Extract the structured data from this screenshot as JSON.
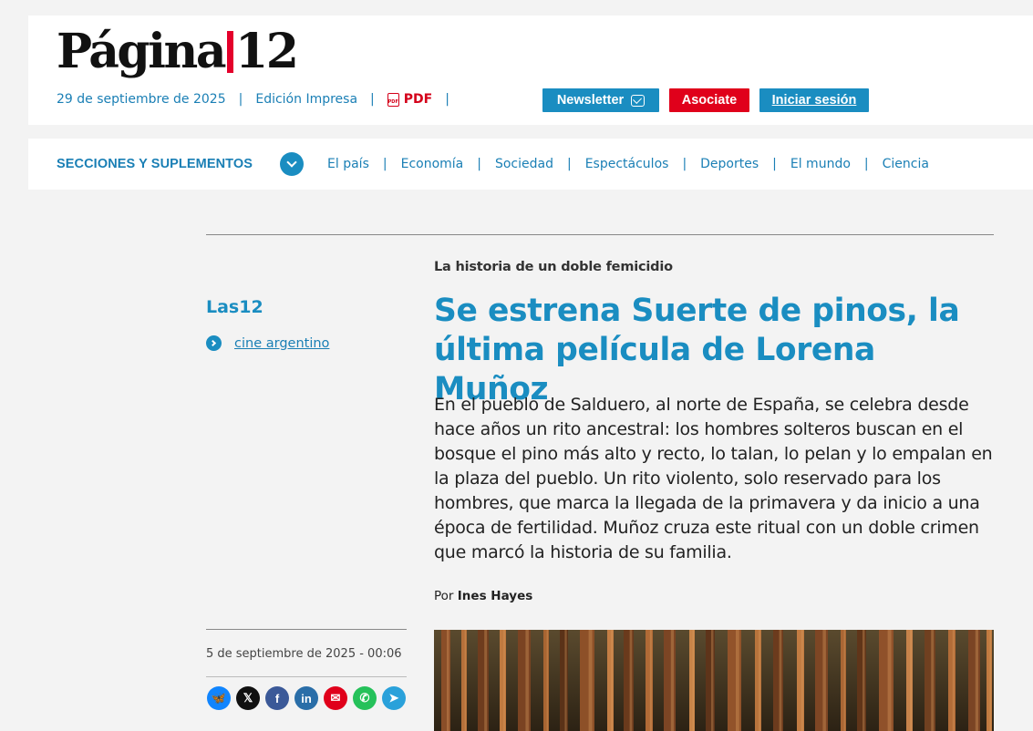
{
  "header": {
    "logo_left": "Página",
    "logo_right": "12",
    "date": "29 de septiembre de 2025",
    "edition": "Edición Impresa",
    "pdf": "PDF",
    "pdf_icon_text": "PDF",
    "separator": "|",
    "buttons": {
      "newsletter": "Newsletter",
      "associate": "Asociate",
      "login": "Iniciar sesión"
    }
  },
  "nav": {
    "title": "SECCIONES Y SUPLEMENTOS",
    "links": [
      "El país",
      "Economía",
      "Sociedad",
      "Espectáculos",
      "Deportes",
      "El mundo",
      "Ciencia"
    ]
  },
  "article": {
    "volanta": "La historia de un doble femicidio",
    "title": "Se estrena Suerte de pinos, la última película de Lorena Muñoz",
    "lede": "En el pueblo de Salduero, al norte de España, se celebra desde hace años un rito ancestral: los hombres solteros buscan en el bosque el pino más alto y recto, lo talan, lo pelan y lo empalan en la plaza del pueblo. Un rito violento, solo reservado para los hombres, que marca la llegada de la primavera y da inicio a una época de fertilidad. Muñoz cruza este ritual con un doble crimen que marcó la historia de su familia.",
    "byline_prefix": "Por",
    "author": "Ines Hayes"
  },
  "sidebar": {
    "section": "Las12",
    "tag": "cine argentino",
    "date": "5 de septiembre de 2025 - 00:06"
  },
  "share": [
    {
      "name": "bluesky-icon",
      "color": "#1185fe",
      "glyph": "🦋"
    },
    {
      "name": "x-icon",
      "color": "#111111",
      "glyph": "𝕏"
    },
    {
      "name": "facebook-icon",
      "color": "#3b5998",
      "glyph": "f"
    },
    {
      "name": "linkedin-icon",
      "color": "#2a6ea8",
      "glyph": "in"
    },
    {
      "name": "email-icon",
      "color": "#e0001b",
      "glyph": "✉"
    },
    {
      "name": "whatsapp-icon",
      "color": "#25c15a",
      "glyph": "✆"
    },
    {
      "name": "telegram-icon",
      "color": "#2aa1da",
      "glyph": "➤"
    }
  ],
  "colors": {
    "accent": "#1a8dc1",
    "red": "#e0001b"
  }
}
